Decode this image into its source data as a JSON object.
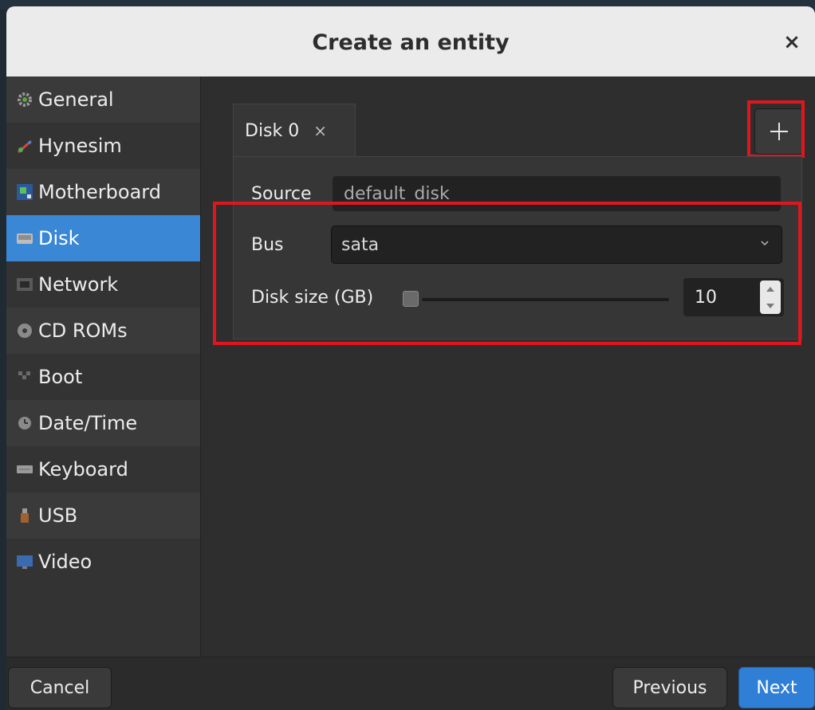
{
  "dialog": {
    "title": "Create an entity",
    "close_icon": "close-icon",
    "close_label": "×"
  },
  "sidebar": {
    "items": [
      {
        "label": "General",
        "icon": "gear-icon"
      },
      {
        "label": "Hynesim",
        "icon": "hynesim-icon"
      },
      {
        "label": "Motherboard",
        "icon": "motherboard-icon"
      },
      {
        "label": "Disk",
        "icon": "disk-icon",
        "selected": true
      },
      {
        "label": "Network",
        "icon": "network-icon"
      },
      {
        "label": "CD ROMs",
        "icon": "cdrom-icon"
      },
      {
        "label": "Boot",
        "icon": "boot-icon"
      },
      {
        "label": "Date/Time",
        "icon": "clock-icon"
      },
      {
        "label": "Keyboard",
        "icon": "keyboard-icon"
      },
      {
        "label": "USB",
        "icon": "usb-icon"
      },
      {
        "label": "Video",
        "icon": "monitor-icon"
      }
    ]
  },
  "tabs": [
    {
      "label": "Disk 0",
      "close_label": "×"
    }
  ],
  "add_button": {
    "icon": "plus-icon"
  },
  "form": {
    "source_label": "Source",
    "source_value": "default_disk",
    "bus_label": "Bus",
    "bus_value": "sata",
    "disk_size_label": "Disk size (GB)",
    "disk_size_value": "10"
  },
  "footer": {
    "cancel_label": "Cancel",
    "previous_label": "Previous",
    "next_label": "Next"
  },
  "colors": {
    "accent": "#3a87d6",
    "highlight": "#e0161f"
  }
}
